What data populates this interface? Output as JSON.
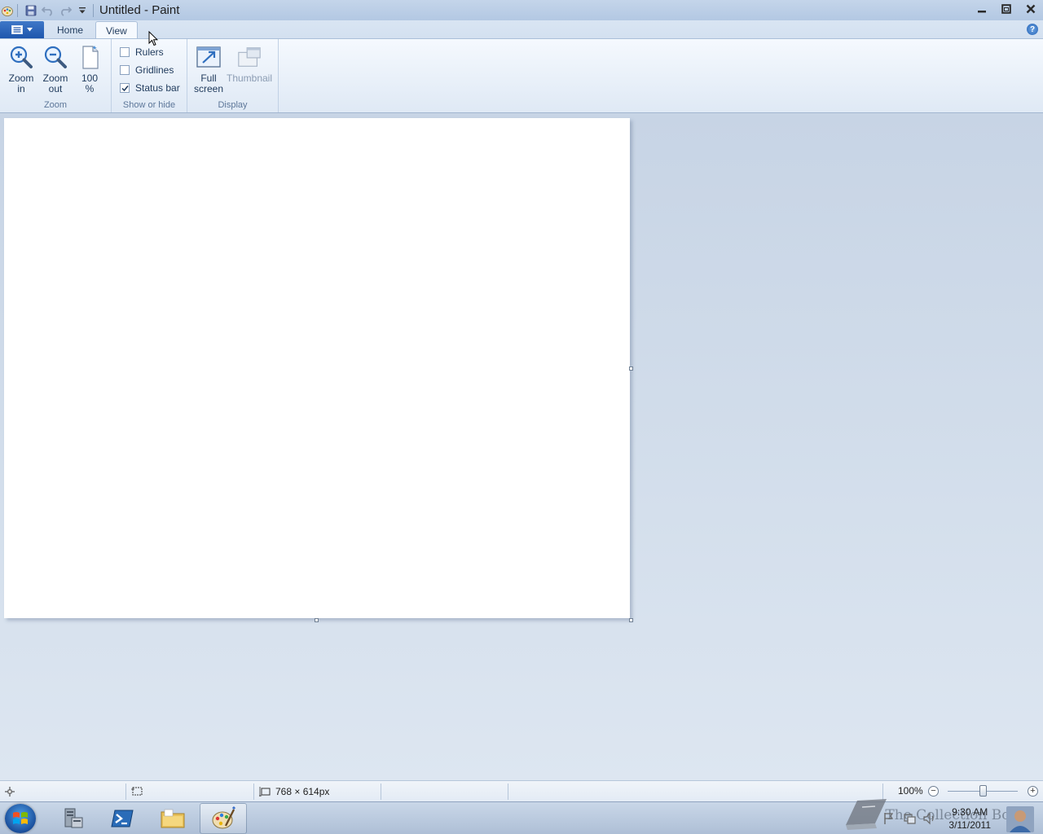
{
  "window": {
    "title": "Untitled - Paint",
    "controls": {
      "minimize": "minimize",
      "restore": "restore",
      "close": "close"
    }
  },
  "quick_access": {
    "icons": [
      "save-icon",
      "undo-icon",
      "redo-icon",
      "customize-dropdown-icon"
    ]
  },
  "ribbon": {
    "tabs": [
      {
        "label": "Home",
        "active": false
      },
      {
        "label": "View",
        "active": true
      }
    ],
    "groups": {
      "zoom": {
        "label": "Zoom",
        "zoom_in": [
          "Zoom",
          "in"
        ],
        "zoom_out": [
          "Zoom",
          "out"
        ],
        "actual": [
          "100",
          "%"
        ]
      },
      "show_hide": {
        "label": "Show or hide",
        "rulers": {
          "label": "Rulers",
          "checked": false
        },
        "gridlines": {
          "label": "Gridlines",
          "checked": false
        },
        "status_bar": {
          "label": "Status bar",
          "checked": true
        }
      },
      "display": {
        "label": "Display",
        "full_screen": [
          "Full",
          "screen"
        ],
        "thumbnail": "Thumbnail"
      }
    }
  },
  "statusbar": {
    "image_size": "768 × 614px",
    "zoom_level": "100%",
    "zoom_minus": "−",
    "zoom_plus": "+"
  },
  "taskbar": {
    "clock_time": "9:30 AM",
    "clock_date": "3/11/2011",
    "watermark": "The Collection Book"
  },
  "colors": {
    "accent": "#1e56ad",
    "ribbon_bg": "#f5f9fe",
    "workspace_bg": "#c9d6e6",
    "canvas_bg": "#ffffff"
  }
}
